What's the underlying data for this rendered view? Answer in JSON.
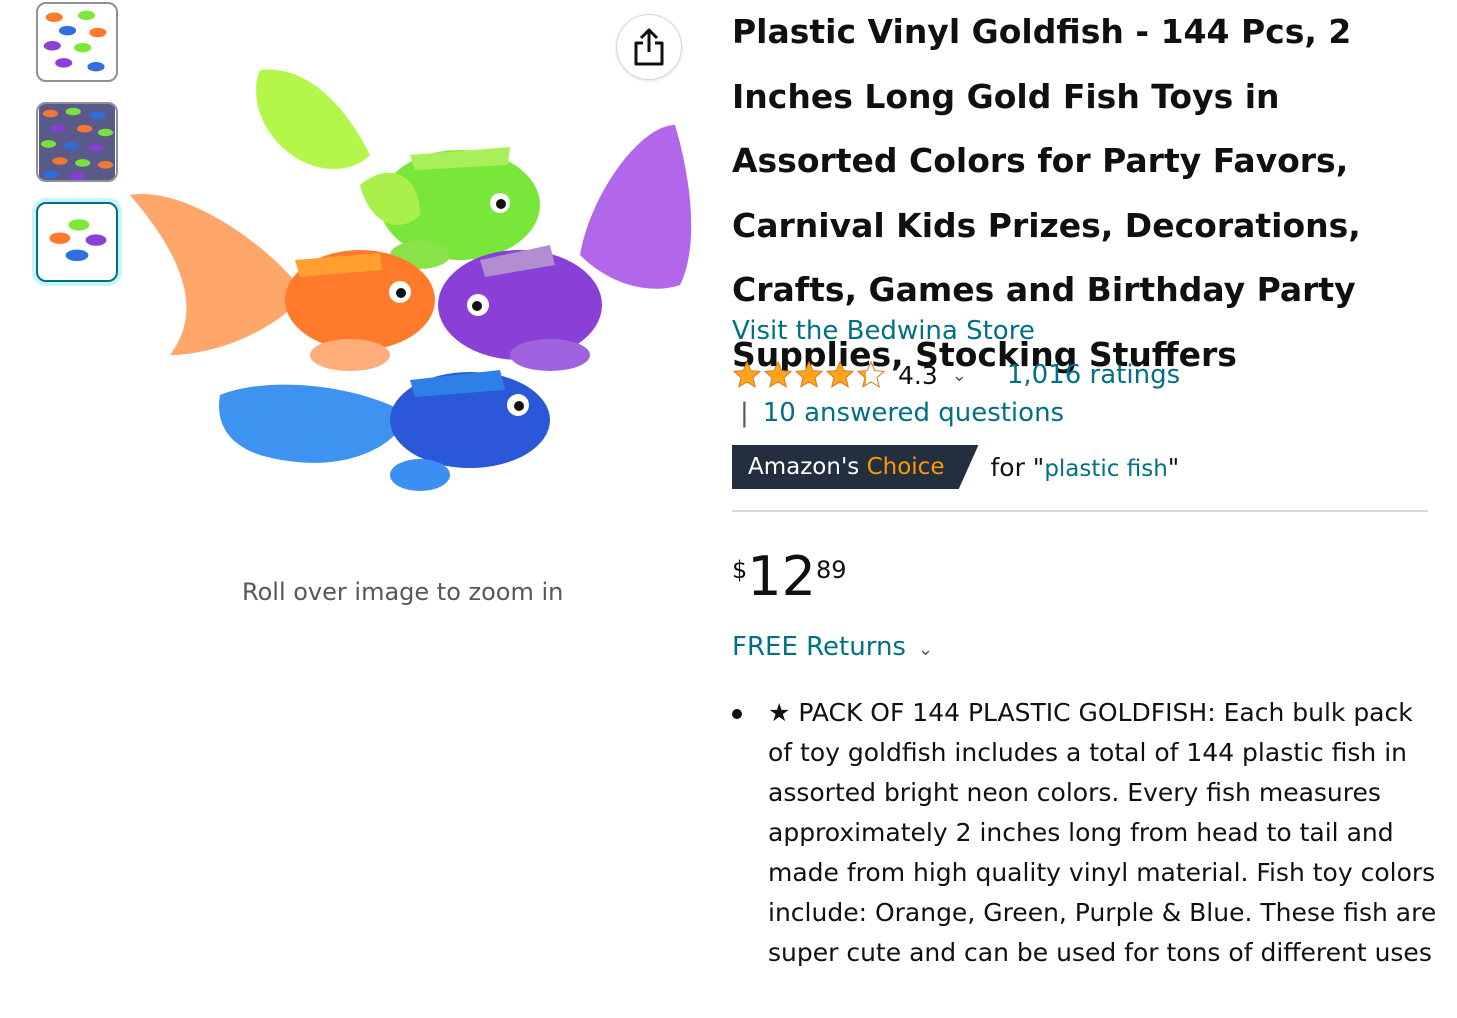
{
  "gallery": {
    "thumbnails": [
      {
        "label": "thumbnail-1",
        "selected": false
      },
      {
        "label": "thumbnail-2",
        "selected": false
      },
      {
        "label": "thumbnail-3",
        "selected": true
      }
    ],
    "zoom_hint": "Roll over image to zoom in",
    "share_icon": "share-icon"
  },
  "product": {
    "title": "Plastic Vinyl Goldfish - 144 Pcs, 2 Inches Long Gold Fish Toys in Assorted Colors for Party Favors, Carnival Kids Prizes, Decorations, Crafts, Games and Birthday Party Supplies, Stocking Stuffers",
    "store_link": "Visit the Bedwina Store",
    "rating_value": "4.3",
    "ratings_count": "1,016 ratings",
    "qa_separator": "|",
    "answered_questions": "10 answered questions",
    "badge": {
      "prefix": "Amazon's",
      "accent": "Choice"
    },
    "choice_for": "for \"",
    "choice_term": "plastic fish",
    "choice_close": "\"",
    "price": {
      "symbol": "$",
      "whole": "12",
      "fraction": "89"
    },
    "returns": "FREE Returns",
    "bullets": [
      "★ PACK OF 144 PLASTIC GOLDFISH: Each bulk pack of toy goldfish includes a total of 144 plastic fish in assorted bright neon colors. Every fish measures approximately 2 inches long from head to tail and made from high quality vinyl material. Fish toy colors include: Orange, Green, Purple & Blue. These fish are super cute and can be used for tons of different uses"
    ]
  },
  "colors": {
    "link": "#007185",
    "star": "#ffa41c",
    "badge_bg": "#232f3e",
    "badge_accent": "#ff9900",
    "fish_green": "#7ee83a",
    "fish_orange": "#ff7a2a",
    "fish_purple": "#8a3fd6",
    "fish_blue": "#2f6fe0"
  }
}
